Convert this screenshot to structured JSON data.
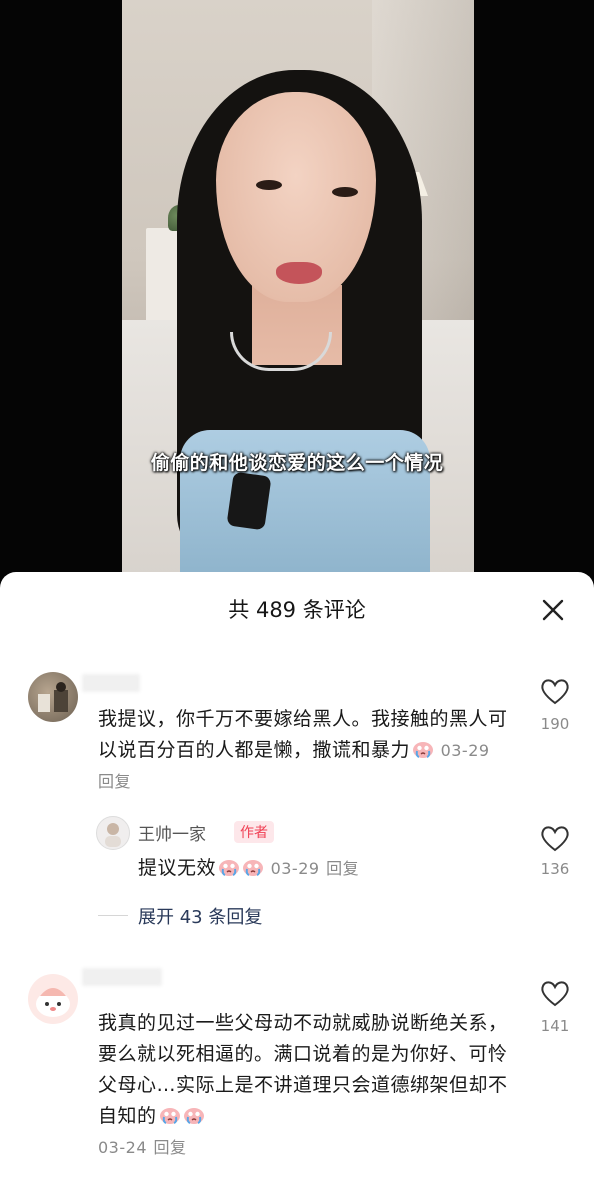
{
  "video": {
    "subtitle": "偷偷的和他谈恋爱的这么一个情况"
  },
  "comments_panel": {
    "title": "共 489 条评论",
    "close_icon": "close-icon",
    "comments": [
      {
        "text": "我提议，你千万不要嫁给黑人。我接触的黑人可以说百分百的人都是懒，撒谎和暴力",
        "emoji": "crying-face-emoji",
        "date": "03-29",
        "reply_label": "回复",
        "likes": "190"
      },
      {
        "author": "王帅一家",
        "badge": "作者",
        "text": "提议无效",
        "emoji": "crying-face-emoji",
        "date": "03-29",
        "reply_label": "回复",
        "likes": "136"
      },
      {
        "text": "我真的见过一些父母动不动就威胁说断绝关系，要么就以死相逼的。满口说着的是为你好、可怜父母心…实际上是不讲道理只会道德绑架但却不自知的",
        "emoji": "crying-face-emoji",
        "date": "03-24",
        "reply_label": "回复",
        "likes": "141"
      }
    ],
    "expand_replies": "展开 43 条回复"
  },
  "colors": {
    "author_badge": "#f04155",
    "muted_text": "#8a8a8a"
  }
}
